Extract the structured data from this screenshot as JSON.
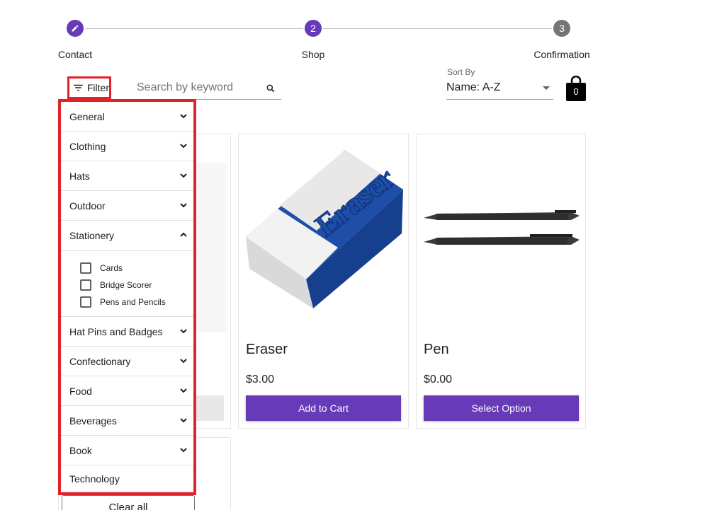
{
  "stepper": {
    "steps": [
      {
        "label": "Contact",
        "marker": "pencil-icon"
      },
      {
        "label": "Shop",
        "marker": "2"
      },
      {
        "label": "Confirmation",
        "marker": "3"
      }
    ]
  },
  "toolbar": {
    "filter_label": "Filter",
    "search_placeholder": "Search by keyword",
    "sort_label": "Sort By",
    "sort_value": "Name: A-Z",
    "cart_count": "0"
  },
  "filters": {
    "categories": [
      {
        "label": "General"
      },
      {
        "label": "Clothing"
      },
      {
        "label": "Hats"
      },
      {
        "label": "Outdoor"
      },
      {
        "label": "Stationery",
        "expanded": true,
        "options": [
          "Cards",
          "Bridge Scorer",
          "Pens and Pencils"
        ]
      },
      {
        "label": "Hat Pins and Badges"
      },
      {
        "label": "Confectionary"
      },
      {
        "label": "Food"
      },
      {
        "label": "Beverages"
      },
      {
        "label": "Book"
      },
      {
        "label": "Technology"
      }
    ],
    "clear_label": "Clear all"
  },
  "products": [
    {
      "name": "Eraser",
      "price": "$3.00",
      "button": "Add to Cart"
    },
    {
      "name": "Pen",
      "price": "$0.00",
      "button": "Select Option"
    }
  ],
  "colors": {
    "accent": "#673ab7",
    "highlight_red": "#e3212b",
    "inactive_step": "#757575"
  }
}
